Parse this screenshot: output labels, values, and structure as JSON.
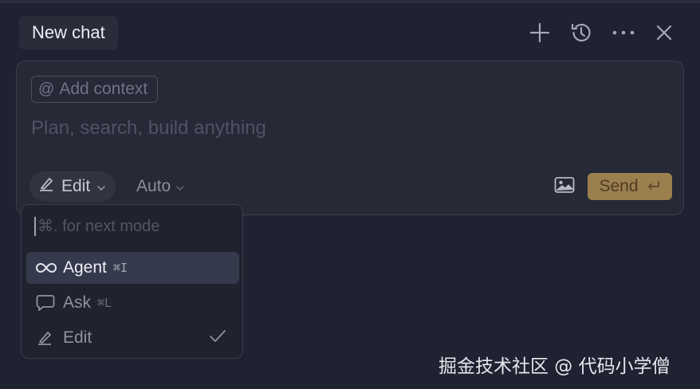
{
  "header": {
    "tab_title": "New chat",
    "icons": [
      "plus-icon",
      "history-icon",
      "more-icon",
      "close-icon"
    ]
  },
  "composer": {
    "add_context_at": "@",
    "add_context_label": "Add context",
    "input_placeholder": "Plan, search, build anything",
    "mode_label": "Edit",
    "model_label": "Auto",
    "send_label": "Send",
    "send_icon": "↩"
  },
  "mode_menu": {
    "hint": "⌘. for next mode",
    "items": [
      {
        "label": "Agent",
        "shortcut": "⌘I",
        "icon": "infinity-icon",
        "highlighted": true
      },
      {
        "label": "Ask",
        "shortcut": "⌘L",
        "icon": "chat-bubble-icon"
      },
      {
        "label": "Edit",
        "shortcut": "",
        "icon": "pencil-icon",
        "selected": true
      }
    ]
  },
  "watermark": "掘金技术社区 @ 代码小学僧",
  "colors": {
    "background": "#1f2230",
    "composer_bg": "#262a36",
    "send_bg": "#9c7f4f",
    "menu_highlight": "#343a4c"
  }
}
